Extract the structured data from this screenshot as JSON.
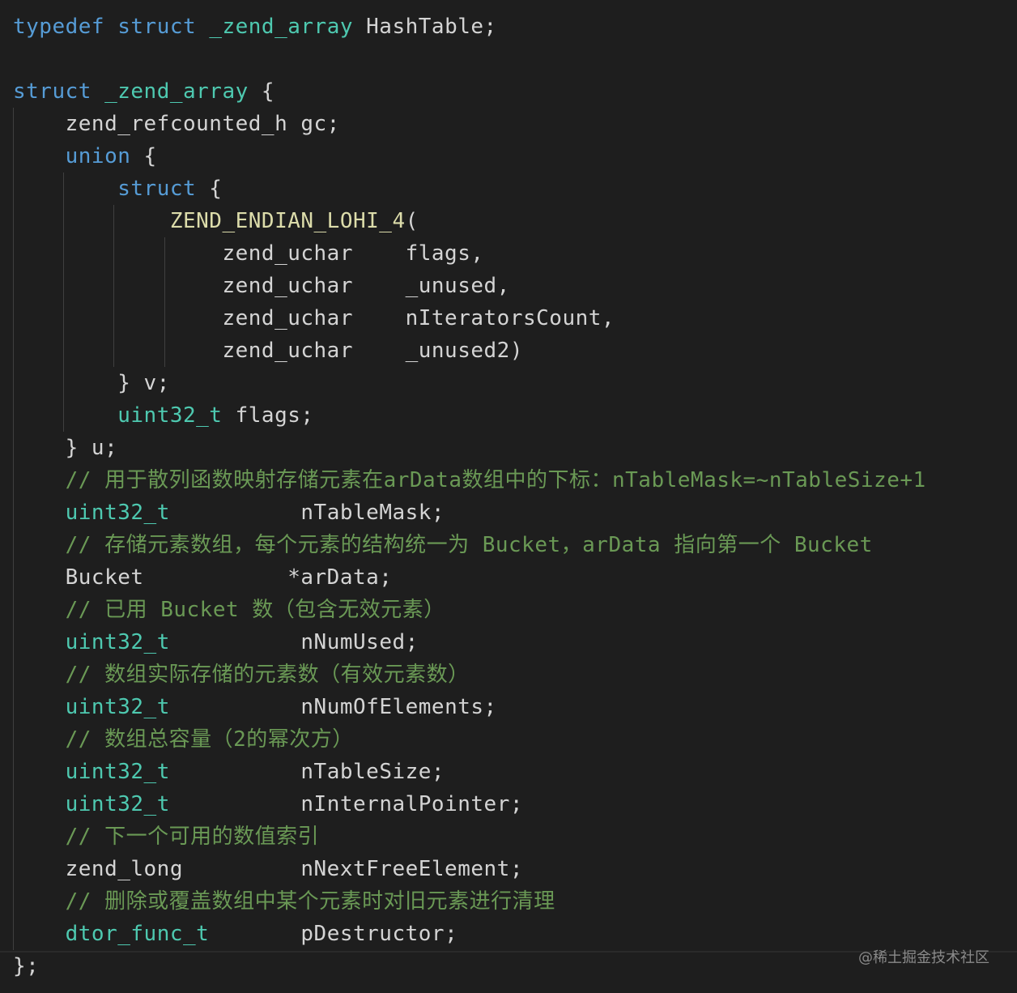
{
  "editor": {
    "background": "#1e1e1e",
    "colors": {
      "keyword": "#569cd6",
      "type": "#4ec9b0",
      "macro": "#dcdcaa",
      "comment": "#6a9955",
      "plain": "#d4d4d4"
    },
    "lines": [
      {
        "tokens": [
          {
            "t": "typedef",
            "c": "kw"
          },
          {
            "t": " ",
            "c": "pl"
          },
          {
            "t": "struct",
            "c": "kw"
          },
          {
            "t": " ",
            "c": "pl"
          },
          {
            "t": "_zend_array",
            "c": "ty"
          },
          {
            "t": " HashTable;",
            "c": "pl"
          }
        ]
      },
      {
        "tokens": []
      },
      {
        "tokens": [
          {
            "t": "struct",
            "c": "kw"
          },
          {
            "t": " ",
            "c": "pl"
          },
          {
            "t": "_zend_array",
            "c": "ty"
          },
          {
            "t": " {",
            "c": "pl"
          }
        ]
      },
      {
        "tokens": [
          {
            "t": "    zend_refcounted_h gc;",
            "c": "pl"
          }
        ]
      },
      {
        "tokens": [
          {
            "t": "    ",
            "c": "pl"
          },
          {
            "t": "union",
            "c": "kw"
          },
          {
            "t": " {",
            "c": "pl"
          }
        ]
      },
      {
        "tokens": [
          {
            "t": "        ",
            "c": "pl"
          },
          {
            "t": "struct",
            "c": "kw"
          },
          {
            "t": " {",
            "c": "pl"
          }
        ]
      },
      {
        "tokens": [
          {
            "t": "            ",
            "c": "pl"
          },
          {
            "t": "ZEND_ENDIAN_LOHI_4",
            "c": "mac"
          },
          {
            "t": "(",
            "c": "pl"
          }
        ]
      },
      {
        "tokens": [
          {
            "t": "                zend_uchar    flags,",
            "c": "pl"
          }
        ]
      },
      {
        "tokens": [
          {
            "t": "                zend_uchar    _unused,",
            "c": "pl"
          }
        ]
      },
      {
        "tokens": [
          {
            "t": "                zend_uchar    nIteratorsCount,",
            "c": "pl"
          }
        ]
      },
      {
        "tokens": [
          {
            "t": "                zend_uchar    _unused2)",
            "c": "pl"
          }
        ]
      },
      {
        "tokens": [
          {
            "t": "        } v;",
            "c": "pl"
          }
        ]
      },
      {
        "tokens": [
          {
            "t": "        ",
            "c": "pl"
          },
          {
            "t": "uint32_t",
            "c": "ty"
          },
          {
            "t": " flags;",
            "c": "pl"
          }
        ]
      },
      {
        "tokens": [
          {
            "t": "    } u;",
            "c": "pl"
          }
        ]
      },
      {
        "tokens": [
          {
            "t": "    // 用于散列函数映射存储元素在arData数组中的下标：nTableMask=~nTableSize+1",
            "c": "cm"
          }
        ]
      },
      {
        "tokens": [
          {
            "t": "    ",
            "c": "pl"
          },
          {
            "t": "uint32_t",
            "c": "ty"
          },
          {
            "t": "          nTableMask;",
            "c": "pl"
          }
        ]
      },
      {
        "tokens": [
          {
            "t": "    // 存储元素数组，每个元素的结构统一为 Bucket，arData 指向第一个 Bucket",
            "c": "cm"
          }
        ]
      },
      {
        "tokens": [
          {
            "t": "    Bucket           *arData;",
            "c": "pl"
          }
        ]
      },
      {
        "tokens": [
          {
            "t": "    // 已用 Bucket 数（包含无效元素）",
            "c": "cm"
          }
        ]
      },
      {
        "tokens": [
          {
            "t": "    ",
            "c": "pl"
          },
          {
            "t": "uint32_t",
            "c": "ty"
          },
          {
            "t": "          nNumUsed;",
            "c": "pl"
          }
        ]
      },
      {
        "tokens": [
          {
            "t": "    // 数组实际存储的元素数（有效元素数）",
            "c": "cm"
          }
        ]
      },
      {
        "tokens": [
          {
            "t": "    ",
            "c": "pl"
          },
          {
            "t": "uint32_t",
            "c": "ty"
          },
          {
            "t": "          nNumOfElements;",
            "c": "pl"
          }
        ]
      },
      {
        "tokens": [
          {
            "t": "    // 数组总容量（2的幂次方）",
            "c": "cm"
          }
        ]
      },
      {
        "tokens": [
          {
            "t": "    ",
            "c": "pl"
          },
          {
            "t": "uint32_t",
            "c": "ty"
          },
          {
            "t": "          nTableSize;",
            "c": "pl"
          }
        ]
      },
      {
        "tokens": [
          {
            "t": "    ",
            "c": "pl"
          },
          {
            "t": "uint32_t",
            "c": "ty"
          },
          {
            "t": "          nInternalPointer;",
            "c": "pl"
          }
        ]
      },
      {
        "tokens": [
          {
            "t": "    // 下一个可用的数值索引",
            "c": "cm"
          }
        ]
      },
      {
        "tokens": [
          {
            "t": "    zend_long         nNextFreeElement;",
            "c": "pl"
          }
        ]
      },
      {
        "tokens": [
          {
            "t": "    // 删除或覆盖数组中某个元素时对旧元素进行清理",
            "c": "cm"
          }
        ]
      },
      {
        "tokens": [
          {
            "t": "    ",
            "c": "pl"
          },
          {
            "t": "dtor_func_t",
            "c": "ty"
          },
          {
            "t": "       pDestructor;",
            "c": "pl"
          }
        ]
      },
      {
        "tokens": [
          {
            "t": "};",
            "c": "pl"
          }
        ]
      }
    ]
  },
  "watermark": "@稀土掘金技术社区"
}
